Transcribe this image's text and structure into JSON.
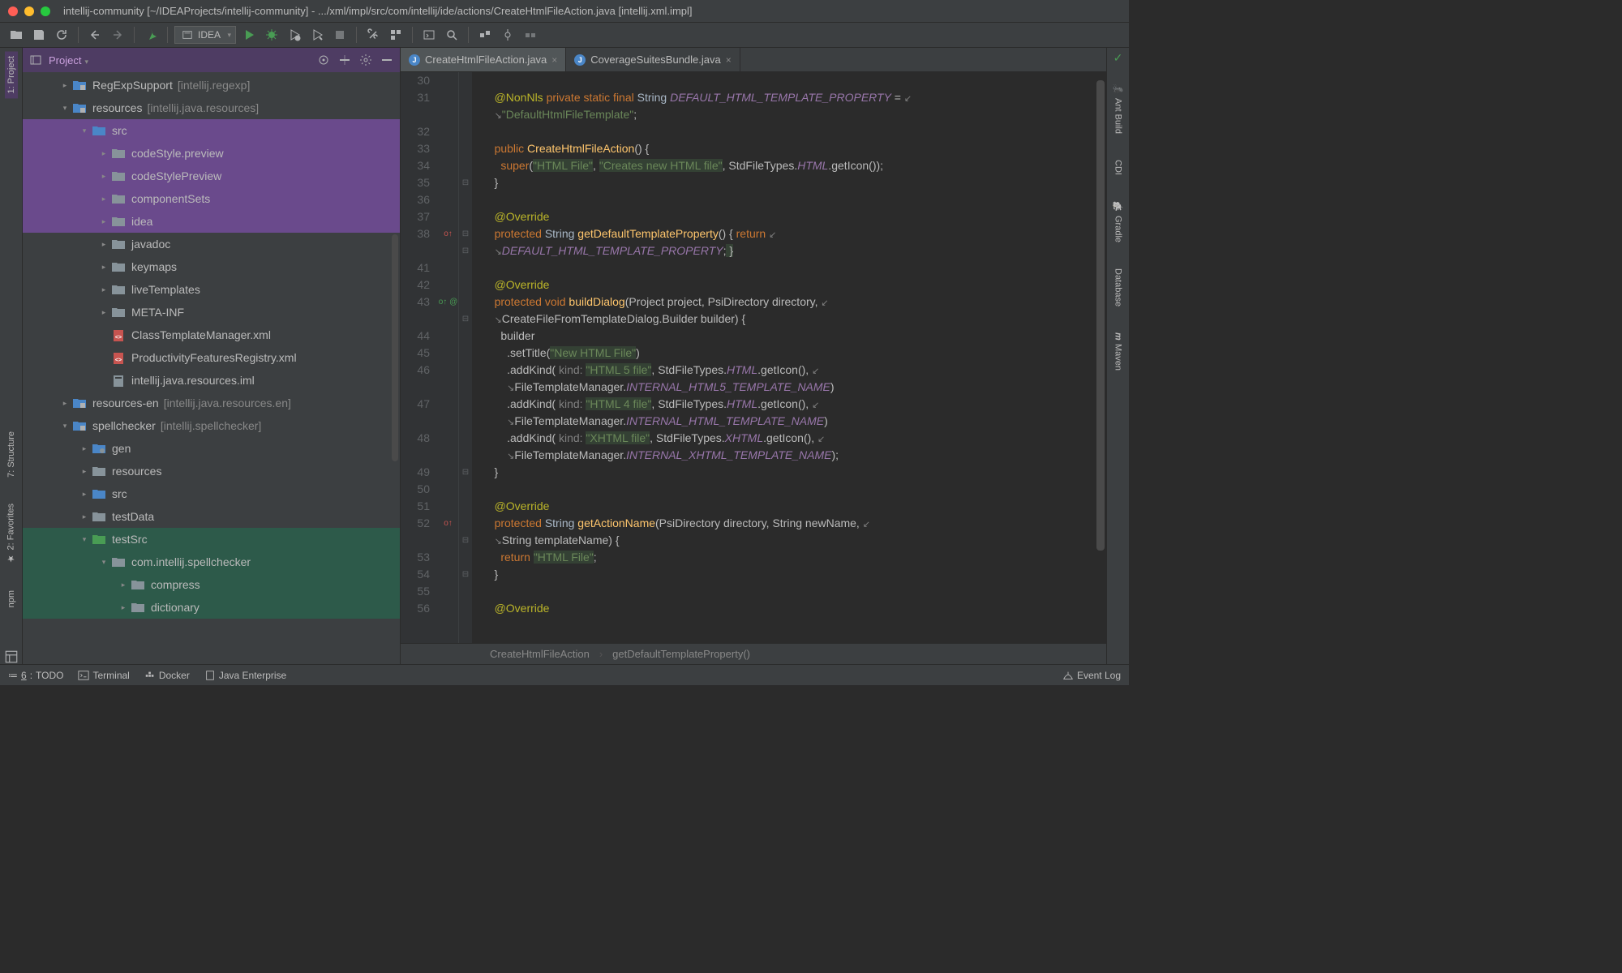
{
  "title": "intellij-community [~/IDEAProjects/intellij-community] - .../xml/impl/src/com/intellij/ide/actions/CreateHtmlFileAction.java [intellij.xml.impl]",
  "config": "IDEA",
  "panel": {
    "title": "Project"
  },
  "tree": [
    {
      "indent": 1,
      "chev": "▸",
      "ico": "mod",
      "label": "RegExpSupport",
      "ctx": "[intellij.regexp]",
      "bold": true
    },
    {
      "indent": 1,
      "chev": "▾",
      "ico": "mod",
      "label": "resources",
      "ctx": "[intellij.java.resources]",
      "bold": true
    },
    {
      "indent": 2,
      "chev": "▾",
      "ico": "src",
      "label": "src",
      "hl": "purple"
    },
    {
      "indent": 3,
      "chev": "▸",
      "ico": "dir",
      "label": "codeStyle.preview",
      "hl": "purple"
    },
    {
      "indent": 3,
      "chev": "▸",
      "ico": "dir",
      "label": "codeStylePreview",
      "hl": "purple"
    },
    {
      "indent": 3,
      "chev": "▸",
      "ico": "dir",
      "label": "componentSets",
      "hl": "purple"
    },
    {
      "indent": 3,
      "chev": "▸",
      "ico": "dir",
      "label": "idea",
      "hl": "purple"
    },
    {
      "indent": 3,
      "chev": "▸",
      "ico": "dir",
      "label": "javadoc"
    },
    {
      "indent": 3,
      "chev": "▸",
      "ico": "dir",
      "label": "keymaps"
    },
    {
      "indent": 3,
      "chev": "▸",
      "ico": "dir",
      "label": "liveTemplates"
    },
    {
      "indent": 3,
      "chev": "▸",
      "ico": "dir",
      "label": "META-INF"
    },
    {
      "indent": 3,
      "chev": "",
      "ico": "xml",
      "label": "ClassTemplateManager.xml"
    },
    {
      "indent": 3,
      "chev": "",
      "ico": "xml",
      "label": "ProductivityFeaturesRegistry.xml"
    },
    {
      "indent": 3,
      "chev": "",
      "ico": "iml",
      "label": "intellij.java.resources.iml"
    },
    {
      "indent": 1,
      "chev": "▸",
      "ico": "mod",
      "label": "resources-en",
      "ctx": "[intellij.java.resources.en]",
      "bold": true
    },
    {
      "indent": 1,
      "chev": "▾",
      "ico": "mod",
      "label": "spellchecker",
      "ctx": "[intellij.spellchecker]",
      "bold": true
    },
    {
      "indent": 2,
      "chev": "▸",
      "ico": "gen",
      "label": "gen"
    },
    {
      "indent": 2,
      "chev": "▸",
      "ico": "dir",
      "label": "resources"
    },
    {
      "indent": 2,
      "chev": "▸",
      "ico": "src",
      "label": "src"
    },
    {
      "indent": 2,
      "chev": "▸",
      "ico": "dir",
      "label": "testData"
    },
    {
      "indent": 2,
      "chev": "▾",
      "ico": "test",
      "label": "testSrc",
      "hl": "teal"
    },
    {
      "indent": 3,
      "chev": "▾",
      "ico": "dir",
      "label": "com.intellij.spellchecker",
      "hl": "teal"
    },
    {
      "indent": 4,
      "chev": "▸",
      "ico": "dir",
      "label": "compress",
      "hl": "teal"
    },
    {
      "indent": 4,
      "chev": "▸",
      "ico": "dir",
      "label": "dictionary",
      "hl": "teal"
    }
  ],
  "tabs": [
    {
      "label": "CreateHtmlFileAction.java",
      "active": true
    },
    {
      "label": "CoverageSuitesBundle.java",
      "active": false
    }
  ],
  "breadcrumb": [
    "CreateHtmlFileAction",
    "getDefaultTemplateProperty()"
  ],
  "left_tools": [
    "1: Project",
    "7: Structure",
    "2: Favorites",
    "npm"
  ],
  "right_tools": [
    "Ant Build",
    "CDI",
    "Gradle",
    "Database",
    "Maven"
  ],
  "statusbar": {
    "items": [
      "6: TODO",
      "Terminal",
      "Docker",
      "Java Enterprise"
    ],
    "eventlog": "Event Log"
  },
  "code_lines": [
    {
      "n": "30",
      "html": ""
    },
    {
      "n": "31",
      "html": "    <span class='anno'>@NonNls</span> <span class='kw'>private static final</span> <span class='ident'>String</span> <span class='const'>DEFAULT_HTML_TEMPLATE_PROPERTY</span> = <span class='arrow-glyph'>↙</span>"
    },
    {
      "n": "",
      "html": "    <span class='arrow-glyph'>↘</span><span class='str'>\"DefaultHtmlFileTemplate\"</span>;"
    },
    {
      "n": "32",
      "html": ""
    },
    {
      "n": "33",
      "html": "    <span class='kw'>public</span> <span class='method'>CreateHtmlFileAction</span>() {"
    },
    {
      "n": "34",
      "html": "      <span class='kw'>super</span>(<span class='str hl-bg'>\"HTML File\"</span>, <span class='str hl-bg'>\"Creates new HTML file\"</span>, StdFileTypes.<span class='const'>HTML</span>.getIcon());"
    },
    {
      "n": "35",
      "html": "    }",
      "fold": "⊟"
    },
    {
      "n": "36",
      "html": ""
    },
    {
      "n": "37",
      "html": "    <span class='anno'>@Override</span>"
    },
    {
      "n": "38",
      "html": "    <span class='kw'>protected</span> <span class='ident'>String</span> <span class='method'>getDefaultTemplateProperty</span>() { <span class='kw'>return</span> <span class='arrow-glyph'>↙</span>",
      "marker": "o↑",
      "mcolor": "#c75450",
      "fold": "⊟"
    },
    {
      "n": "",
      "html": "    <span class='arrow-glyph'>↘</span><span class='const'>DEFAULT_HTML_TEMPLATE_PROPERTY</span>;<span class='hl-bg'> }</span>",
      "fold": "⊟"
    },
    {
      "n": "41",
      "html": ""
    },
    {
      "n": "42",
      "html": "    <span class='anno'>@Override</span>"
    },
    {
      "n": "43",
      "html": "    <span class='kw'>protected void</span> <span class='method'>buildDialog</span>(Project project, PsiDirectory directory, <span class='arrow-glyph'>↙</span>",
      "marker": "o↑ @",
      "mcolor": "#499c54"
    },
    {
      "n": "",
      "html": "    <span class='arrow-glyph'>↘</span>CreateFileFromTemplateDialog.Builder builder) {",
      "fold": "⊟"
    },
    {
      "n": "44",
      "html": "      builder"
    },
    {
      "n": "45",
      "html": "        .setTitle(<span class='str hl-bg'>\"New HTML File\"</span>)"
    },
    {
      "n": "46",
      "html": "        .addKind(<span class='param'> kind: </span><span class='str hl-bg'>\"HTML 5 file\"</span>, StdFileTypes.<span class='const'>HTML</span>.getIcon(), <span class='arrow-glyph'>↙</span>"
    },
    {
      "n": "",
      "html": "        <span class='arrow-glyph'>↘</span>FileTemplateManager.<span class='const'>INTERNAL_HTML5_TEMPLATE_NAME</span>)"
    },
    {
      "n": "47",
      "html": "        .addKind(<span class='param'> kind: </span><span class='str hl-bg'>\"HTML 4 file\"</span>, StdFileTypes.<span class='const'>HTML</span>.getIcon(), <span class='arrow-glyph'>↙</span>"
    },
    {
      "n": "",
      "html": "        <span class='arrow-glyph'>↘</span>FileTemplateManager.<span class='const'>INTERNAL_HTML_TEMPLATE_NAME</span>)"
    },
    {
      "n": "48",
      "html": "        .addKind(<span class='param'> kind: </span><span class='str hl-bg'>\"XHTML file\"</span>, StdFileTypes.<span class='const'>XHTML</span>.getIcon(), <span class='arrow-glyph'>↙</span>"
    },
    {
      "n": "",
      "html": "        <span class='arrow-glyph'>↘</span>FileTemplateManager.<span class='const'>INTERNAL_XHTML_TEMPLATE_NAME</span>);"
    },
    {
      "n": "49",
      "html": "    }",
      "fold": "⊟"
    },
    {
      "n": "50",
      "html": ""
    },
    {
      "n": "51",
      "html": "    <span class='anno'>@Override</span>"
    },
    {
      "n": "52",
      "html": "    <span class='kw'>protected</span> <span class='ident'>String</span> <span class='method'>getActionName</span>(PsiDirectory directory, String newName, <span class='arrow-glyph'>↙</span>",
      "marker": "o↑",
      "mcolor": "#c75450"
    },
    {
      "n": "",
      "html": "    <span class='arrow-glyph'>↘</span>String templateName) {",
      "fold": "⊟"
    },
    {
      "n": "53",
      "html": "      <span class='kw'>return</span> <span class='str hl-bg'>\"HTML File\"</span>;"
    },
    {
      "n": "54",
      "html": "    }",
      "fold": "⊟"
    },
    {
      "n": "55",
      "html": ""
    },
    {
      "n": "56",
      "html": "    <span class='anno'>@Override</span>"
    }
  ]
}
